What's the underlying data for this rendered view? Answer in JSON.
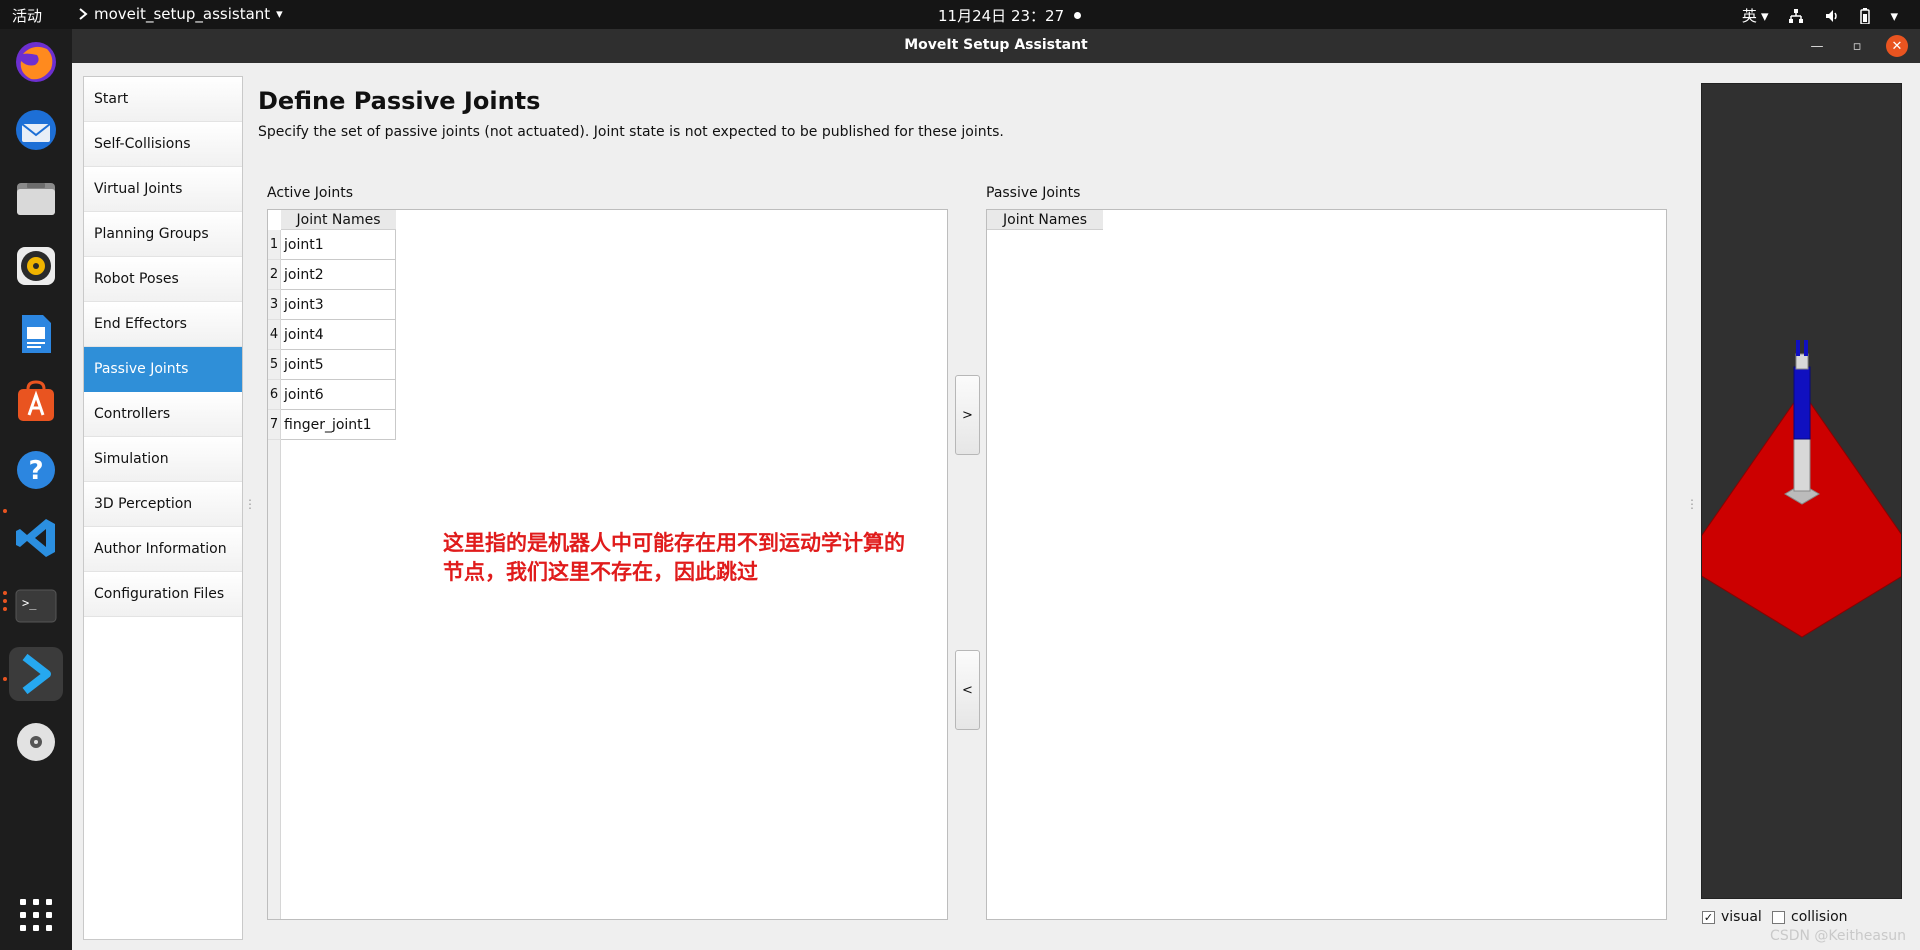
{
  "topbar": {
    "activities": "活动",
    "app_name": "moveit_setup_assistant",
    "clock": "11月24日 23：27",
    "ime": "英"
  },
  "window": {
    "title": "MoveIt Setup Assistant"
  },
  "sidebar": {
    "items": [
      {
        "label": "Start"
      },
      {
        "label": "Self-Collisions"
      },
      {
        "label": "Virtual Joints"
      },
      {
        "label": "Planning Groups"
      },
      {
        "label": "Robot Poses"
      },
      {
        "label": "End Effectors"
      },
      {
        "label": "Passive Joints",
        "active": true
      },
      {
        "label": "Controllers"
      },
      {
        "label": "Simulation"
      },
      {
        "label": "3D Perception"
      },
      {
        "label": "Author Information"
      },
      {
        "label": "Configuration Files"
      }
    ]
  },
  "main": {
    "title": "Define Passive Joints",
    "description": "Specify the set of passive joints (not actuated). Joint state is not expected to be published for these joints.",
    "active_joints": {
      "label": "Active Joints",
      "column": "Joint Names",
      "rows": [
        {
          "num": "1",
          "name": "joint1"
        },
        {
          "num": "2",
          "name": "joint2"
        },
        {
          "num": "3",
          "name": "joint3"
        },
        {
          "num": "4",
          "name": "joint4"
        },
        {
          "num": "5",
          "name": "joint5"
        },
        {
          "num": "6",
          "name": "joint6"
        },
        {
          "num": "7",
          "name": "finger_joint1"
        }
      ]
    },
    "passive_joints": {
      "label": "Passive Joints",
      "column": "Joint Names"
    },
    "buttons": {
      "move_right": ">",
      "move_left": "<"
    },
    "annotation": {
      "line1": "这里指的是机器人中可能存在用不到运动学计算的",
      "line2": "节点，我们这里不存在，因此跳过"
    }
  },
  "viewer": {
    "visual_label": "visual",
    "visual_checked": true,
    "collision_label": "collision",
    "collision_checked": false,
    "floor_color": "#cc0000",
    "robot_color": "#1010c0"
  },
  "watermark": "CSDN @Keitheasun"
}
